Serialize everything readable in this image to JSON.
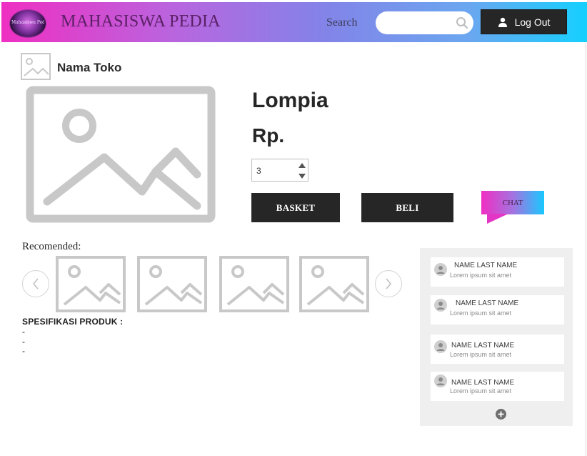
{
  "header": {
    "logo_text": "Mahasiswa Pedia",
    "brand": "MAHASISWA PEDIA",
    "search_label": "Search",
    "search_placeholder": "",
    "logout_label": "Log Out"
  },
  "store": {
    "name": "Nama Toko"
  },
  "product": {
    "name": "Lompia",
    "price": "Rp.",
    "quantity": "3",
    "basket_label": "BASKET",
    "buy_label": "BELI",
    "chat_label": "CHAT"
  },
  "recommended": {
    "label": "Recomended:"
  },
  "spec": {
    "title": "SPESIFIKASI PRODUK :",
    "items": [
      "-",
      "-",
      "-"
    ]
  },
  "chats": [
    {
      "name": "NAME LAST NAME",
      "message": "Lorem ipsum sit amet"
    },
    {
      "name": "NAME LAST NAME",
      "message": "Lorem ipsum sit amet"
    },
    {
      "name": "NAME LAST NAME",
      "message": "Lorem ipsum sit amet"
    },
    {
      "name": "NAME LAST NAME",
      "message": "Lorem ipsum sit amet"
    }
  ],
  "colors": {
    "header_gradient_start": "#ef2fc2",
    "header_gradient_end": "#15d0ff",
    "button_dark": "#262626",
    "placeholder_gray": "#c8c8c8"
  },
  "icons": {
    "search": "search-icon",
    "user": "user-icon",
    "add": "plus-circle-icon",
    "prev": "chevron-left-icon",
    "next": "chevron-right-icon"
  }
}
